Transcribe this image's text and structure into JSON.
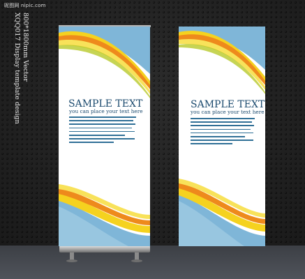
{
  "watermark": "昵图网 nipic.com",
  "side_caption": {
    "line1": "XQQ017 Display template design",
    "line2": "800*1800mm Vector"
  },
  "banners": [
    {
      "title": "SAMPLE TEXT",
      "subtitle": "you can place your text here",
      "colors": {
        "sky": "#7fb6d8",
        "yellow": "#f5d21f",
        "orange": "#ee8a1c",
        "green": "#b8c92a"
      }
    },
    {
      "title": "SAMPLE TEXT",
      "subtitle": "you can place your text here",
      "colors": {
        "sky": "#7fb6d8",
        "yellow": "#f5d21f",
        "orange": "#ee8a1c",
        "green": "#b8c92a"
      }
    }
  ],
  "colors": {
    "background": "#2b2b2b",
    "text": "#1b4a6e"
  }
}
